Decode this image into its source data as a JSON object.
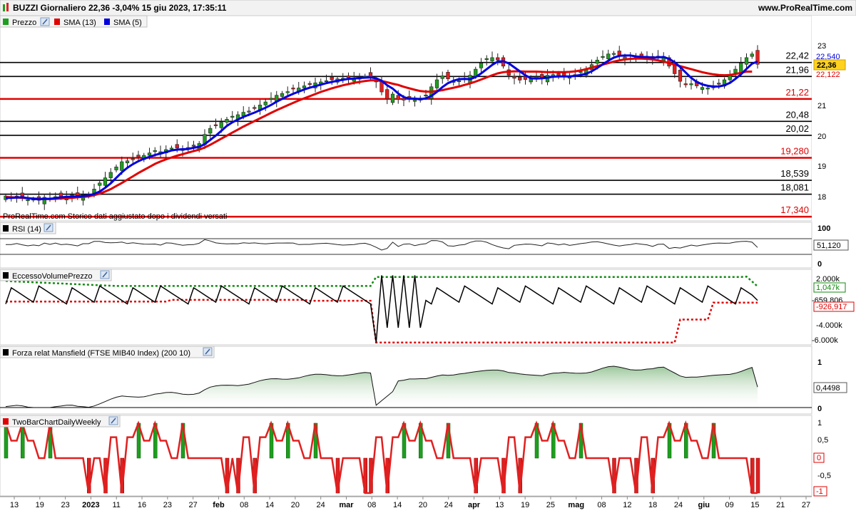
{
  "header": {
    "title": "BUZZI Giornaliero 22,36 -3,04% 15 giu 2023, 17:35:11",
    "site": "www.ProRealTime.com"
  },
  "legend": {
    "price": "Prezzo",
    "sma13": "SMA (13)",
    "sma5": "SMA (5)",
    "note": "ProRealTime.com Storico dati aggiustato dopo i dividendi versati"
  },
  "panels": {
    "rsi": {
      "title": "RSI (14)",
      "ticks": [
        "100",
        "0"
      ],
      "value": "51,120"
    },
    "evp": {
      "title": "EccessoVolumePrezzo",
      "ticks": [
        "2.000k",
        "-4.000k",
        "-6.000k"
      ],
      "upper": "1,047k",
      "line": "-659,806",
      "lower": "-926,917"
    },
    "mansfield": {
      "title": "Forza relat Mansfield (FTSE MIB40 Index) (200 10)",
      "ticks": [
        "1",
        "0"
      ],
      "value": "0,4498"
    },
    "twobar": {
      "title": "TwoBarChartDailyWeekly",
      "ticks": [
        "1",
        "0,5",
        "-0,5"
      ],
      "zero": "0",
      "last": "-1"
    }
  },
  "price_axis": {
    "ticks": [
      "23",
      "21",
      "20",
      "19",
      "18"
    ],
    "tags": [
      "22,540",
      "22,36",
      "22,122"
    ]
  },
  "levels": [
    {
      "label": "22,42",
      "color": "#000000"
    },
    {
      "label": "21,96",
      "color": "#000000"
    },
    {
      "label": "21,22",
      "color": "#e00000"
    },
    {
      "label": "20,48",
      "color": "#000000"
    },
    {
      "label": "20,02",
      "color": "#000000"
    },
    {
      "label": "19,280",
      "color": "#e00000"
    },
    {
      "label": "18,539",
      "color": "#000000"
    },
    {
      "label": "18,081",
      "color": "#000000"
    },
    {
      "label": "17,340",
      "color": "#e00000"
    }
  ],
  "x_axis": [
    "13",
    "19",
    "23",
    "2023",
    "11",
    "16",
    "23",
    "27",
    "feb",
    "08",
    "14",
    "20",
    "24",
    "mar",
    "08",
    "14",
    "20",
    "24",
    "apr",
    "13",
    "19",
    "25",
    "mag",
    "08",
    "12",
    "18",
    "24",
    "giu",
    "09",
    "15",
    "21",
    "27"
  ],
  "colors": {
    "up": "#1e9e1e",
    "down": "#e02020",
    "sma13": "#e00000",
    "sma5": "#0000dd"
  },
  "chart_data": {
    "type": "candlestick",
    "title": "BUZZI Giornaliero",
    "ylim": [
      17.0,
      23.3
    ],
    "close": [
      18.02,
      17.98,
      18.0,
      17.96,
      17.9,
      17.92,
      17.88,
      17.98,
      17.95,
      18.0,
      17.97,
      18.02,
      18.05,
      18.0,
      18.06,
      18.08,
      18.25,
      18.45,
      18.62,
      18.8,
      18.98,
      19.15,
      19.18,
      19.25,
      19.3,
      19.36,
      19.44,
      19.52,
      19.48,
      19.55,
      19.6,
      19.6,
      19.58,
      19.62,
      19.66,
      19.75,
      20.05,
      20.25,
      20.35,
      20.45,
      20.55,
      20.65,
      20.7,
      20.78,
      20.82,
      20.92,
      21.02,
      21.12,
      21.24,
      21.34,
      21.4,
      21.46,
      21.55,
      21.58,
      21.65,
      21.7,
      21.75,
      21.78,
      21.82,
      21.85,
      21.88,
      21.9,
      21.92,
      21.91,
      21.93,
      21.97,
      21.94,
      21.78,
      21.45,
      21.22,
      21.38,
      21.2,
      21.18,
      21.22,
      21.18,
      21.25,
      21.35,
      21.62,
      21.85,
      21.98,
      21.88,
      21.8,
      21.82,
      21.86,
      22.0,
      22.2,
      22.4,
      22.55,
      22.58,
      22.5,
      22.3,
      22.0,
      21.9,
      21.84,
      21.86,
      21.92,
      21.95,
      21.9,
      22.0,
      22.02,
      21.95,
      21.98,
      21.96,
      22.02,
      22.12,
      22.22,
      22.35,
      22.5,
      22.62,
      22.7,
      22.72,
      22.65,
      22.6,
      22.55,
      22.58,
      22.6,
      22.62,
      22.55,
      22.6,
      22.62,
      22.3,
      22.05,
      21.8,
      21.7,
      21.72,
      21.65,
      21.6,
      21.58,
      21.62,
      21.72,
      21.85,
      22.0,
      22.2,
      22.4,
      22.58,
      22.7,
      22.36
    ],
    "sma5": [
      17.96,
      17.96,
      17.97,
      17.98,
      17.95,
      17.93,
      17.91,
      17.93,
      17.93,
      17.95,
      17.98,
      17.99,
      18.0,
      18.01,
      18.02,
      18.04,
      18.09,
      18.17,
      18.29,
      18.44,
      18.62,
      18.8,
      18.95,
      19.07,
      19.17,
      19.25,
      19.31,
      19.37,
      19.42,
      19.47,
      19.52,
      19.55,
      19.56,
      19.57,
      19.61,
      19.64,
      19.73,
      19.87,
      20.01,
      20.17,
      20.33,
      20.45,
      20.54,
      20.63,
      20.7,
      20.77,
      20.85,
      20.93,
      21.02,
      21.13,
      21.22,
      21.31,
      21.39,
      21.46,
      21.53,
      21.59,
      21.64,
      21.69,
      21.74,
      21.78,
      21.82,
      21.85,
      21.88,
      21.89,
      21.91,
      21.92,
      21.93,
      21.9,
      21.82,
      21.67,
      21.56,
      21.4,
      21.28,
      21.23,
      21.23,
      21.21,
      21.24,
      21.32,
      21.45,
      21.61,
      21.74,
      21.82,
      21.87,
      21.88,
      21.87,
      21.94,
      22.06,
      22.2,
      22.34,
      22.45,
      22.46,
      22.39,
      22.26,
      22.13,
      22.0,
      21.9,
      21.89,
      21.9,
      21.92,
      21.95,
      21.96,
      21.96,
      21.96,
      21.98,
      22.01,
      22.05,
      22.13,
      22.24,
      22.36,
      22.48,
      22.58,
      22.64,
      22.65,
      22.65,
      22.62,
      22.6,
      22.6,
      22.58,
      22.59,
      22.6,
      22.54,
      22.43,
      22.27,
      22.09,
      21.91,
      21.78,
      21.7,
      21.65,
      21.63,
      21.63,
      21.67,
      21.75,
      21.88,
      22.03,
      22.21,
      22.38,
      22.45
    ],
    "sma13": [
      17.99,
      17.98,
      17.97,
      17.96,
      17.95,
      17.94,
      17.93,
      17.92,
      17.92,
      17.93,
      17.94,
      17.95,
      17.96,
      17.98,
      17.99,
      18.01,
      18.05,
      18.1,
      18.17,
      18.25,
      18.35,
      18.45,
      18.56,
      18.67,
      18.78,
      18.88,
      18.98,
      19.08,
      19.16,
      19.23,
      19.29,
      19.35,
      19.4,
      19.45,
      19.5,
      19.55,
      19.62,
      19.71,
      19.81,
      19.91,
      20.01,
      20.11,
      20.21,
      20.31,
      20.4,
      20.49,
      20.58,
      20.67,
      20.76,
      20.85,
      20.93,
      21.01,
      21.09,
      21.17,
      21.24,
      21.31,
      21.38,
      21.45,
      21.51,
      21.57,
      21.62,
      21.67,
      21.71,
      21.75,
      21.78,
      21.81,
      21.83,
      21.83,
      21.81,
      21.77,
      21.72,
      21.68,
      21.62,
      21.57,
      21.52,
      21.48,
      21.46,
      21.46,
      21.48,
      21.51,
      21.55,
      21.59,
      21.63,
      21.68,
      21.73,
      21.79,
      21.86,
      21.93,
      22.0,
      22.06,
      22.1,
      22.12,
      22.13,
      22.13,
      22.12,
      22.12,
      22.12,
      22.11,
      22.1,
      22.1,
      22.1,
      22.1,
      22.11,
      22.13,
      22.16,
      22.2,
      22.25,
      22.3,
      22.35,
      22.4,
      22.45,
      22.49,
      22.52,
      22.54,
      22.55,
      22.55,
      22.54,
      22.52,
      22.49,
      22.45,
      22.4,
      22.35,
      22.3,
      22.25,
      22.2,
      22.15,
      22.1,
      22.06,
      22.03,
      22.01,
      22.0,
      22.01,
      22.04,
      22.08,
      22.12,
      22.12
    ],
    "rsi_last": 51.12,
    "mansfield_last": 0.4498,
    "evp_last": -659.806,
    "twobar_last": -1
  }
}
